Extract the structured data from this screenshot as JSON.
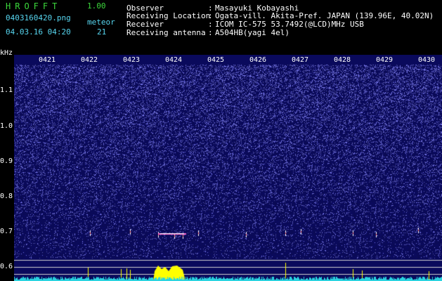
{
  "header": {
    "app_name": "HROFFT",
    "version": "1.00",
    "filename": "0403160420.png",
    "datetime": "04.03.16 04:20",
    "meteor_label": "meteor",
    "meteor_count": "21",
    "info": [
      {
        "label": "Observer",
        "value": "Masayuki Kobayashi"
      },
      {
        "label": "Receiving Location",
        "value": "Ogata-vill. Akita-Pref. JAPAN (139.96E, 40.02N)"
      },
      {
        "label": "Receiver",
        "value": "ICOM IC-575 53.7492(@LCD)MHz USB"
      },
      {
        "label": "Receiving antenna",
        "value": "A504HB(yagi 4el)"
      }
    ]
  },
  "spectrogram": {
    "y_unit": "kHz",
    "y_ticks": [
      "1.1",
      "1.0",
      "0.9",
      "0.8",
      "0.7",
      "0.6"
    ],
    "x_ticks": [
      "0421",
      "0422",
      "0423",
      "0424",
      "0425",
      "0426",
      "0427",
      "0428",
      "0429",
      "0430"
    ],
    "colors": {
      "background": "#0a0a5c",
      "noise": "#6a6aff",
      "echo": "#ffffff",
      "histogram": "#ffff00",
      "baseline_noise": "#2ad4e0"
    }
  }
}
